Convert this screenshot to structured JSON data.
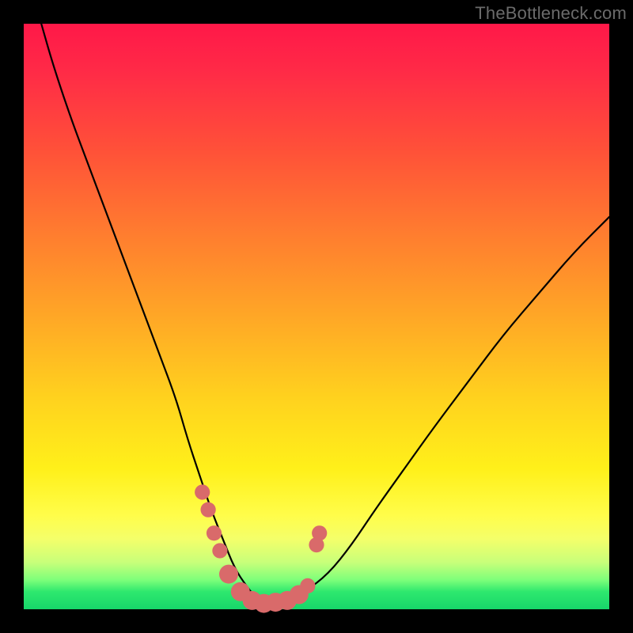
{
  "watermark": "TheBottleneck.com",
  "colors": {
    "frame": "#000000",
    "gradient_top": "#ff1848",
    "gradient_mid": "#ffd21e",
    "gradient_bottom": "#17d66a",
    "curve": "#000000",
    "marker": "#d96a6a"
  },
  "chart_data": {
    "type": "line",
    "title": "",
    "xlabel": "",
    "ylabel": "",
    "xlim": [
      0,
      100
    ],
    "ylim": [
      0,
      100
    ],
    "grid": false,
    "legend": false,
    "series": [
      {
        "name": "bottleneck-curve",
        "x": [
          3,
          5,
          8,
          11,
          14,
          17,
          20,
          23,
          26,
          28,
          30,
          32,
          34,
          36,
          38,
          40,
          42,
          45,
          48,
          52,
          56,
          60,
          65,
          70,
          76,
          82,
          88,
          94,
          100
        ],
        "values": [
          100,
          93,
          84,
          76,
          68,
          60,
          52,
          44,
          36,
          29,
          23,
          17,
          12,
          7,
          4,
          1.5,
          1,
          1.5,
          3,
          6,
          11,
          17,
          24,
          31,
          39,
          47,
          54,
          61,
          67
        ]
      }
    ],
    "markers": [
      {
        "x": 30.5,
        "y": 20,
        "size": 4
      },
      {
        "x": 31.5,
        "y": 17,
        "size": 4
      },
      {
        "x": 32.5,
        "y": 13,
        "size": 4
      },
      {
        "x": 33.5,
        "y": 10,
        "size": 4
      },
      {
        "x": 35,
        "y": 6,
        "size": 5
      },
      {
        "x": 37,
        "y": 3,
        "size": 5
      },
      {
        "x": 39,
        "y": 1.5,
        "size": 5
      },
      {
        "x": 41,
        "y": 1,
        "size": 5
      },
      {
        "x": 43,
        "y": 1.2,
        "size": 5
      },
      {
        "x": 45,
        "y": 1.5,
        "size": 5
      },
      {
        "x": 47,
        "y": 2.5,
        "size": 5
      },
      {
        "x": 48.5,
        "y": 4,
        "size": 4
      },
      {
        "x": 50,
        "y": 11,
        "size": 4
      },
      {
        "x": 50.5,
        "y": 13,
        "size": 4
      }
    ]
  }
}
